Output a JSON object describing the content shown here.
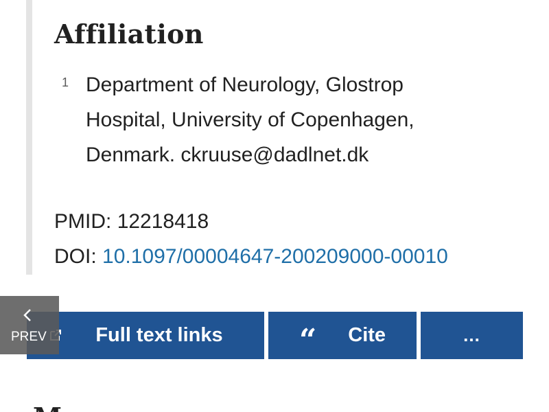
{
  "affiliation": {
    "heading": "Affiliation",
    "items": [
      {
        "number": "1",
        "text": "Department of Neurology, Glostrop Hospital, University of Copenhagen, Denmark. ckruuse@dadlnet.dk"
      }
    ]
  },
  "identifiers": {
    "pmid_label": "PMID:",
    "pmid_value": "12218418",
    "doi_label": "DOI:",
    "doi_value": "10.1097/00004647-200209000-00010"
  },
  "actions": {
    "full_text_label": "Full text links",
    "cite_label": "Cite",
    "cite_icon_glyph": "“",
    "more_label": "...",
    "button_color": "#205493",
    "link_color": "#1f6fa8"
  },
  "nav": {
    "prev_label": "PREV"
  },
  "next_section": {
    "heading_fragment": "M"
  },
  "icons": {
    "external_link": "external-link-icon",
    "quote": "quote-icon",
    "chevron_left": "chevron-left-icon"
  }
}
